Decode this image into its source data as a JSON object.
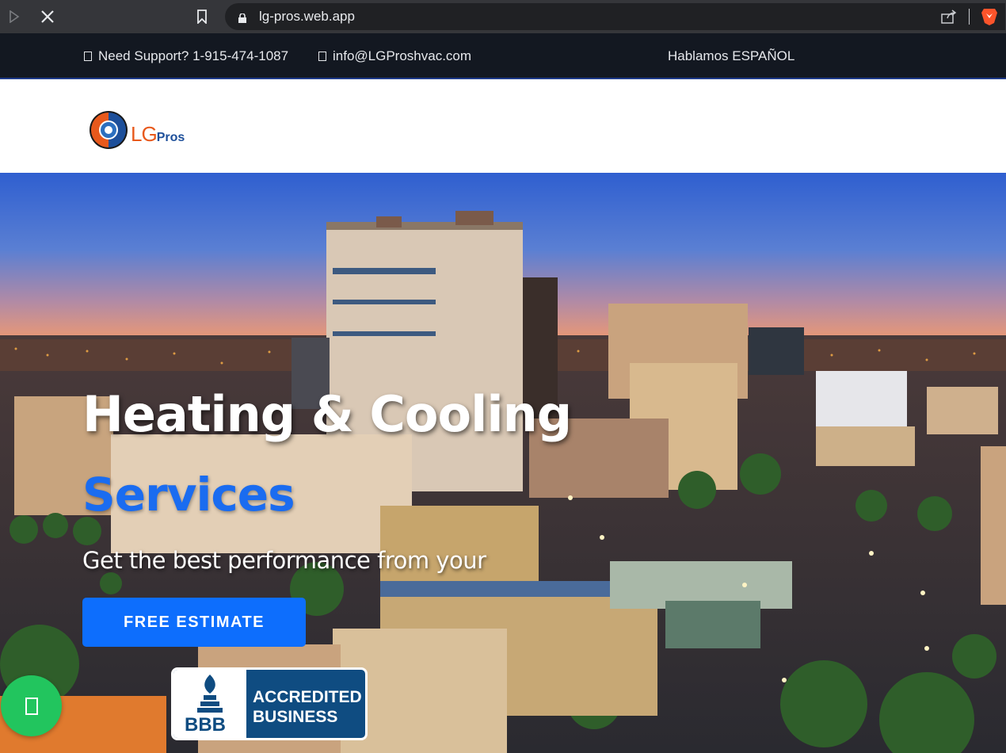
{
  "browser": {
    "url": "lg-pros.web.app"
  },
  "topbar": {
    "support": "Need Support? 1-915-474-1087",
    "email": "info@LGProshvac.com",
    "language": "Hablamos ESPAÑOL"
  },
  "header": {
    "logo_lg": "LG",
    "logo_pros": "Pros"
  },
  "hero": {
    "title_line1": "Heating & Cooling",
    "title_line2": "Services",
    "subtitle": "Get the best performance from your",
    "cta_label": "FREE ESTIMATE",
    "badge_line1": "ACCREDITED",
    "badge_line2": "BUSINESS",
    "badge_logo": "BBB"
  },
  "colors": {
    "accent": "#0d6efd",
    "topbar_bg": "#131821",
    "chat_button": "#22c55e"
  }
}
